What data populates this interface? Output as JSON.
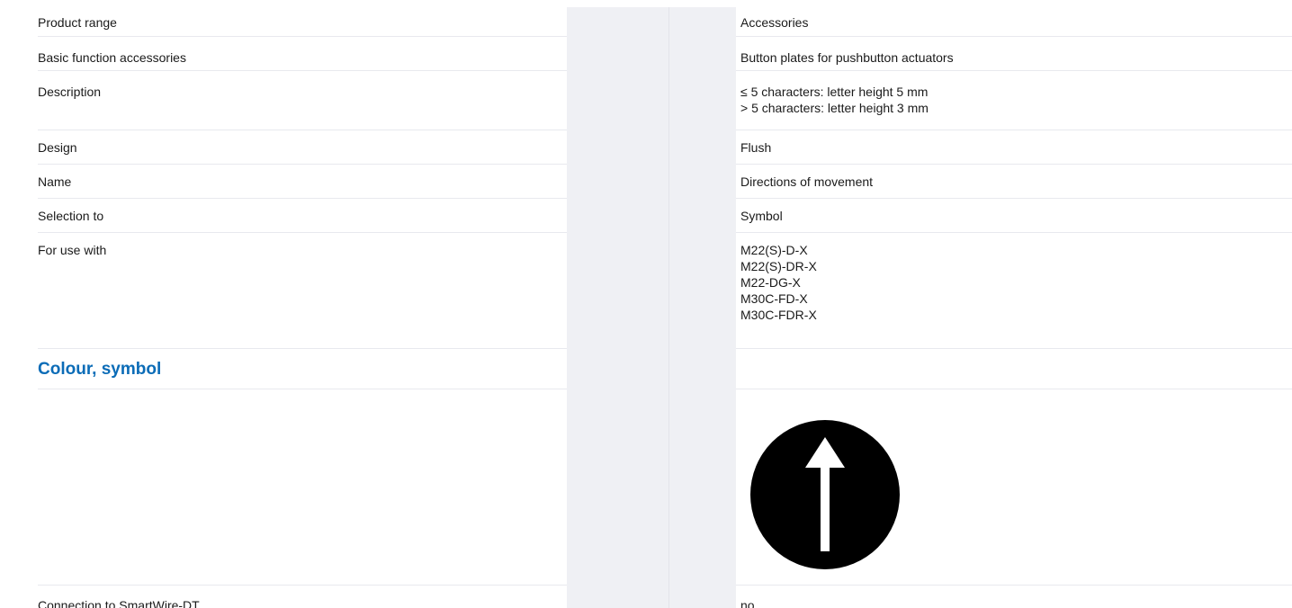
{
  "section_heading": "Colour, symbol",
  "rows": [
    {
      "label": "Product range",
      "value": [
        "Accessories"
      ]
    },
    {
      "label": "Basic function accessories",
      "value": [
        "Button plates for pushbutton actuators"
      ]
    },
    {
      "label": "Description",
      "value": [
        "≤ 5 characters: letter height 5 mm",
        "> 5 characters: letter height 3 mm"
      ]
    },
    {
      "label": "Design",
      "value": [
        "Flush"
      ]
    },
    {
      "label": "Name",
      "value": [
        "Directions of movement"
      ]
    },
    {
      "label": "Selection to",
      "value": [
        "Symbol"
      ]
    },
    {
      "label": "For use with",
      "value": [
        "M22(S)-D-X",
        "M22(S)-DR-X",
        "M22-DG-X",
        "M30C-FD-X",
        "M30C-FDR-X"
      ]
    }
  ],
  "symbol": {
    "icon": "arrow-up-icon",
    "background": "#000000",
    "foreground": "#ffffff"
  },
  "last_row": {
    "label": "Connection to SmartWire-DT",
    "value": "no"
  }
}
